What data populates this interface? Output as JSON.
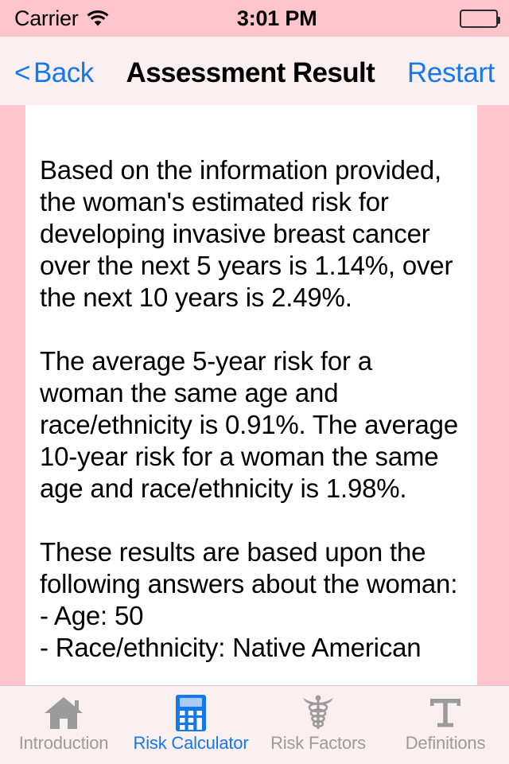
{
  "status_bar": {
    "carrier": "Carrier",
    "wifi_icon": "wifi-icon",
    "time": "3:01 PM",
    "battery_icon": "battery-full-icon"
  },
  "nav_bar": {
    "back_label": "Back",
    "back_chevron": "<",
    "title": "Assessment Result",
    "action_label": "Restart"
  },
  "content": {
    "result_text": "Based on the information provided, the woman's estimated risk for developing invasive breast cancer over the next 5 years is 1.14%, over the next 10 years is 2.49%.\n\nThe average 5-year risk for a woman the same age and race/ethnicity is 0.91%. The average 10-year risk for a woman the same age and race/ethnicity is 1.98%.\n\nThese results are based upon the following answers about the woman:\n- Age: 50\n- Race/ethnicity: Native American",
    "risk_5_year": "1.14%",
    "risk_10_year": "2.49%",
    "average_5_year": "0.91%",
    "average_10_year": "1.98%",
    "answers": [
      "- Age: 50",
      "- Race/ethnicity: Native American"
    ]
  },
  "tab_bar": {
    "items": [
      {
        "label": "Introduction",
        "icon": "home-icon",
        "active": false
      },
      {
        "label": "Risk Calculator",
        "icon": "calculator-icon",
        "active": true
      },
      {
        "label": "Risk Factors",
        "icon": "caduceus-icon",
        "active": false
      },
      {
        "label": "Definitions",
        "icon": "letter-t-icon",
        "active": false
      }
    ]
  },
  "colors": {
    "accent_blue": "#1478f0",
    "status_pink": "#ffc4cc",
    "bar_pink": "#fbeff0",
    "inactive_gray": "#9b9b9b"
  }
}
